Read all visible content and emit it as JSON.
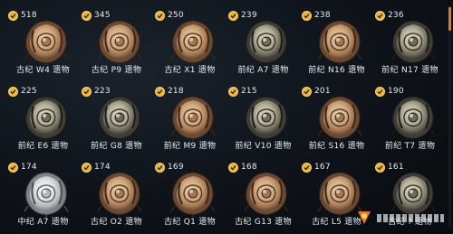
{
  "relics": [
    {
      "count": "518",
      "label": "古纪 W4 遗物",
      "variant": "intact"
    },
    {
      "count": "345",
      "label": "古纪 P9 遗物",
      "variant": "intact"
    },
    {
      "count": "250",
      "label": "古纪 X1 遗物",
      "variant": "intact"
    },
    {
      "count": "239",
      "label": "前纪 A7 遗物",
      "variant": "exceptional"
    },
    {
      "count": "238",
      "label": "前纪 N16 遗物",
      "variant": "intact"
    },
    {
      "count": "236",
      "label": "前纪 N17 遗物",
      "variant": "exceptional"
    },
    {
      "count": "225",
      "label": "前纪 E6 遗物",
      "variant": "exceptional"
    },
    {
      "count": "223",
      "label": "前纪 G8 遗物",
      "variant": "exceptional"
    },
    {
      "count": "218",
      "label": "前纪 M9 遗物",
      "variant": "intact"
    },
    {
      "count": "215",
      "label": "前纪 V10 遗物",
      "variant": "exceptional"
    },
    {
      "count": "201",
      "label": "前纪 S16 遗物",
      "variant": "intact"
    },
    {
      "count": "190",
      "label": "前纪 T7 遗物",
      "variant": "exceptional"
    },
    {
      "count": "174",
      "label": "中纪 A7 遗物",
      "variant": "flawless"
    },
    {
      "count": "174",
      "label": "古纪 O2 遗物",
      "variant": "intact"
    },
    {
      "count": "169",
      "label": "古纪 Q1 遗物",
      "variant": "intact"
    },
    {
      "count": "168",
      "label": "古纪 G13 遗物",
      "variant": "intact"
    },
    {
      "count": "167",
      "label": "古纪 L5 遗物",
      "variant": "intact"
    },
    {
      "count": "161",
      "label": "古纪 ? 遗物",
      "variant": "exceptional"
    }
  ],
  "colors": {
    "badge": "#e8b43a",
    "scroll_thumb": "#e07a26",
    "bronze": "#8a5a3a",
    "silver": "#c9ccd0",
    "dark": "#3a3a36"
  },
  "icons": {
    "check": "check-icon",
    "relic": "relic-icon"
  }
}
